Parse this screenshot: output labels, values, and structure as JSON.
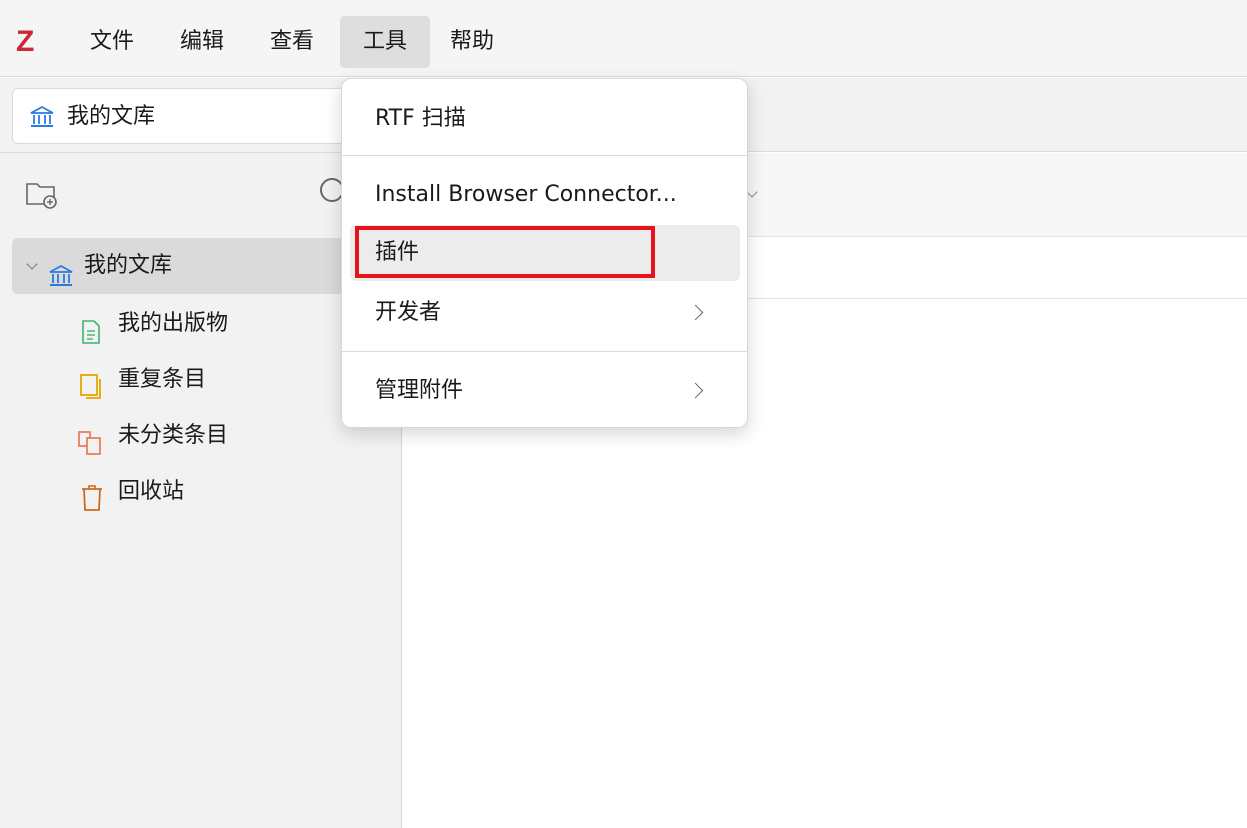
{
  "app": {
    "logo_text": "Z",
    "logo_color": "#cc2936"
  },
  "menubar": {
    "items": [
      {
        "label": "文件"
      },
      {
        "label": "编辑"
      },
      {
        "label": "查看"
      },
      {
        "label": "工具",
        "active": true
      },
      {
        "label": "帮助"
      }
    ]
  },
  "library_tab": {
    "label": "我的文库",
    "icon": "library-icon"
  },
  "sidebar": {
    "new_collection_icon": "new-collection-icon",
    "tree": [
      {
        "label": "我的文库",
        "icon": "library-icon",
        "selected": true,
        "expanded": true
      },
      {
        "label": "我的出版物",
        "icon": "publications-icon",
        "color": "#3cb371"
      },
      {
        "label": "重复条目",
        "icon": "duplicate-items-icon",
        "color": "#e8a500"
      },
      {
        "label": "未分类条目",
        "icon": "unfiled-items-icon",
        "color": "#e8734a"
      },
      {
        "label": "回收站",
        "icon": "trash-icon",
        "color": "#d2691e"
      }
    ]
  },
  "tools_menu": {
    "items": [
      {
        "label": "RTF 扫描"
      },
      {
        "label": "Install Browser Connector..."
      },
      {
        "label": "插件",
        "hovered": true,
        "highlighted": true
      },
      {
        "label": "开发者",
        "has_submenu": true
      },
      {
        "label": "管理附件",
        "has_submenu": true
      }
    ]
  },
  "colors": {
    "highlight_box": "#e8121a",
    "library_icon": "#2a7ae2"
  }
}
